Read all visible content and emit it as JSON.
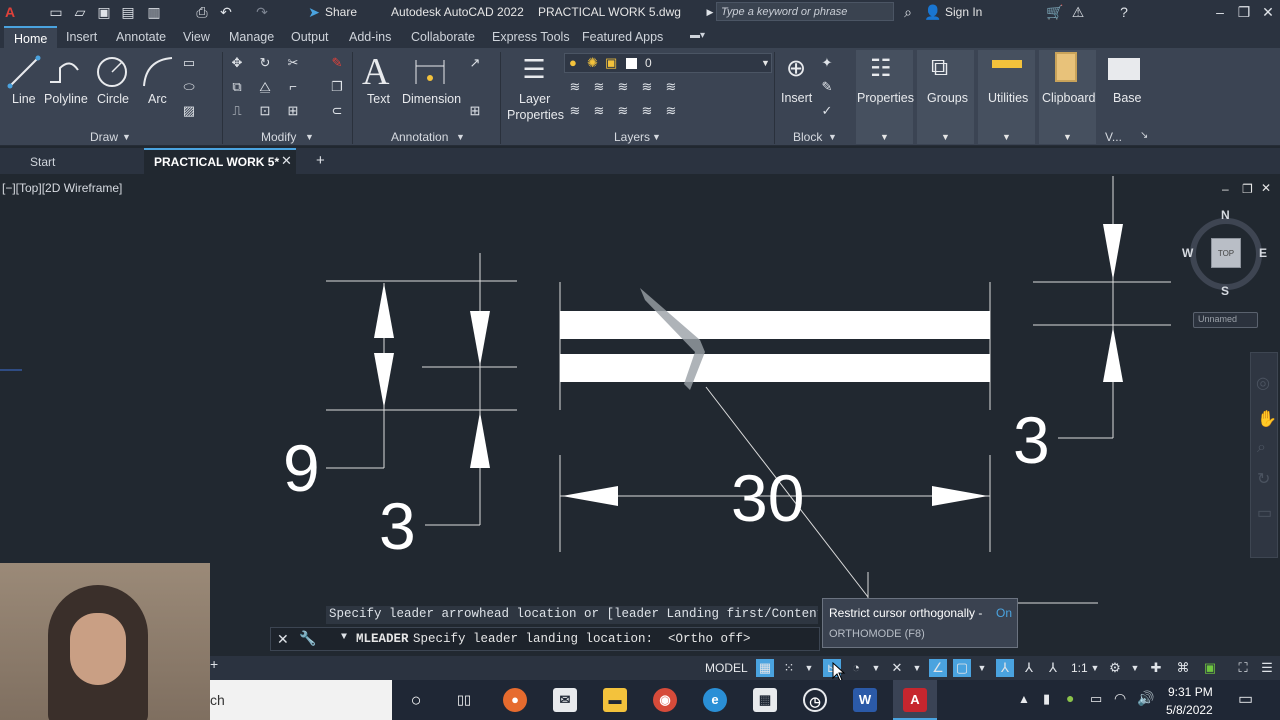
{
  "titlebar": {
    "app_title": "Autodesk AutoCAD 2022",
    "file_title": "PRACTICAL WORK 5.dwg",
    "share_label": "Share",
    "search_placeholder": "Type a keyword or phrase",
    "signin_label": "Sign In"
  },
  "ribbon_tabs": [
    "Home",
    "Insert",
    "Annotate",
    "View",
    "Manage",
    "Output",
    "Add-ins",
    "Collaborate",
    "Express Tools",
    "Featured Apps"
  ],
  "ribbon": {
    "draw": {
      "line": "Line",
      "polyline": "Polyline",
      "circle": "Circle",
      "arc": "Arc",
      "title": "Draw"
    },
    "modify": {
      "title": "Modify"
    },
    "annotation": {
      "text": "Text",
      "dimension": "Dimension",
      "title": "Annotation"
    },
    "layers": {
      "layer_properties_1": "Layer",
      "layer_properties_2": "Properties",
      "current_layer": "0",
      "title": "Layers"
    },
    "block": {
      "insert": "Insert",
      "title": "Block"
    },
    "properties": "Properties",
    "groups": "Groups",
    "utilities": "Utilities",
    "clipboard": "Clipboard",
    "base": "Base",
    "view_short": "V..."
  },
  "doc_tabs": {
    "start": "Start",
    "active": "PRACTICAL WORK 5*"
  },
  "viewport": {
    "label": "[−][Top][2D Wireframe]",
    "viewcube": {
      "n": "N",
      "s": "S",
      "e": "E",
      "w": "W",
      "top": "TOP",
      "ucs": "Unnamed"
    },
    "dimensions": {
      "d9": "9",
      "d3_left": "3",
      "d30": "30",
      "d3_right": "3"
    }
  },
  "command": {
    "history": "Specify leader arrowhead location or [leader Landing first/Content",
    "command_name": "MLEADER",
    "prompt": "Specify leader landing location:  <Ortho off>"
  },
  "tooltip": {
    "title": "Restrict cursor orthogonally - ",
    "state": "On",
    "subtitle": "ORTHOMODE (F8)"
  },
  "statusbar": {
    "model": "MODEL",
    "scale": "1:1"
  },
  "taskbar": {
    "search_text": "ch",
    "time": "9:31 PM",
    "date": "5/8/2022"
  },
  "colors": {
    "accent": "#4aa3df",
    "background": "#212830",
    "ribbon": "#3b4453",
    "tooltip_on": "#4aa3df"
  }
}
